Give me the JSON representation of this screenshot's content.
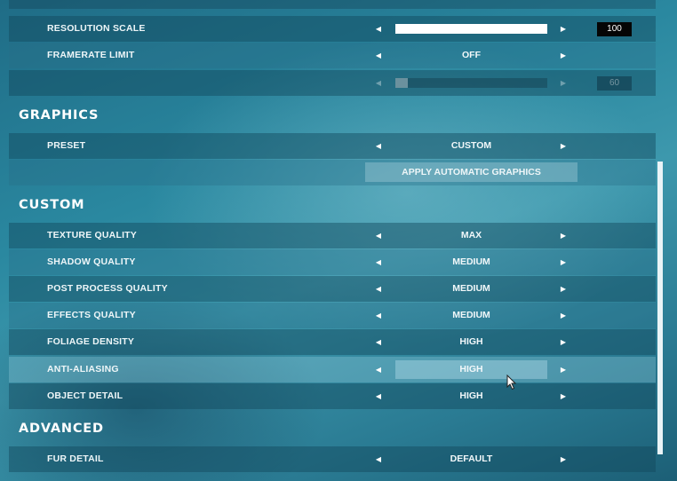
{
  "display": {
    "resolution_scale": {
      "label": "RESOLUTION SCALE",
      "value": "100",
      "fill": 1.0
    },
    "framerate_limit": {
      "label": "FRAMERATE LIMIT",
      "value": "OFF"
    },
    "framerate_cap": {
      "value": "60",
      "fill": 0.08,
      "enabled": false
    }
  },
  "graphics": {
    "heading": "GRAPHICS",
    "preset": {
      "label": "PRESET",
      "value": "CUSTOM"
    },
    "apply_button": "APPLY AUTOMATIC GRAPHICS"
  },
  "custom": {
    "heading": "CUSTOM",
    "texture_quality": {
      "label": "TEXTURE QUALITY",
      "value": "MAX"
    },
    "shadow_quality": {
      "label": "SHADOW QUALITY",
      "value": "MEDIUM"
    },
    "post_process_quality": {
      "label": "POST PROCESS QUALITY",
      "value": "MEDIUM"
    },
    "effects_quality": {
      "label": "EFFECTS QUALITY",
      "value": "MEDIUM"
    },
    "foliage_density": {
      "label": "FOLIAGE DENSITY",
      "value": "HIGH"
    },
    "anti_aliasing": {
      "label": "ANTI-ALIASING",
      "value": "HIGH"
    },
    "object_detail": {
      "label": "OBJECT DETAIL",
      "value": "HIGH"
    }
  },
  "advanced": {
    "heading": "ADVANCED",
    "fur_detail": {
      "label": "FUR DETAIL",
      "value": "DEFAULT"
    }
  },
  "icons": {
    "left_arrow": "◀",
    "right_arrow": "▶"
  },
  "colors": {
    "background": "#2a88a0",
    "row": "#12465c",
    "text": "#ffffff",
    "number_box": "#050505"
  }
}
